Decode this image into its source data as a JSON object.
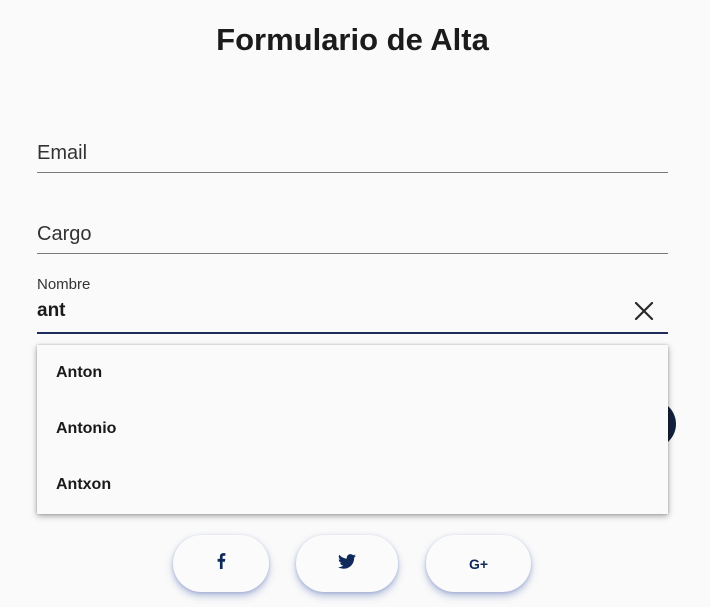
{
  "form": {
    "title": "Formulario de Alta",
    "email": {
      "placeholder": "Email"
    },
    "cargo": {
      "placeholder": "Cargo"
    },
    "nombre": {
      "label": "Nombre",
      "value": "ant"
    }
  },
  "autocomplete": {
    "options": [
      "Anton",
      "Antonio",
      "Antxon"
    ]
  },
  "social": {
    "buttons": [
      {
        "icon": "facebook-icon"
      },
      {
        "icon": "twitter-icon"
      },
      {
        "icon": "google-plus-icon",
        "text": "G+"
      }
    ]
  },
  "colors": {
    "accent": "#1e2d5c",
    "social_icon": "#0f2a5a",
    "background": "#fafafa"
  }
}
